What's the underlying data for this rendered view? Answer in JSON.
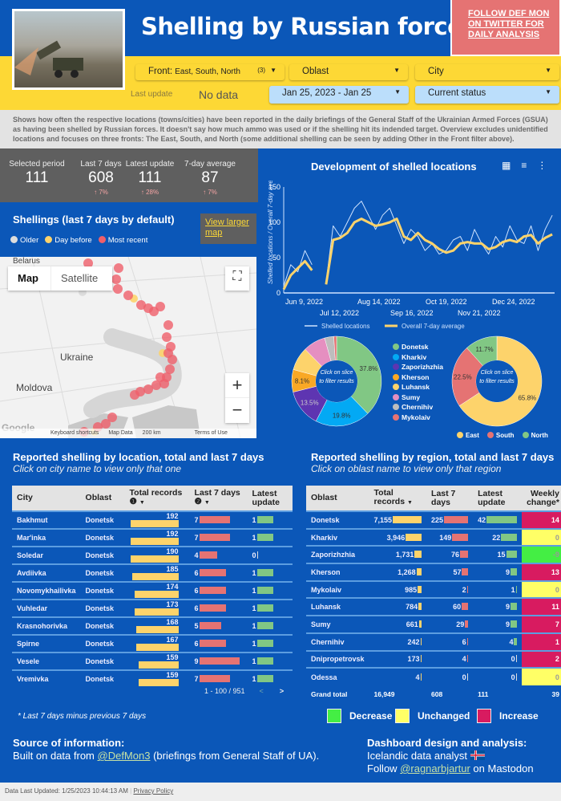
{
  "header": {
    "title": "Shelling by Russian forces",
    "follow_link": "FOLLOW DEF MON ON TWITTER FOR DAILY ANALYSIS",
    "image_alt": "rocket launcher firing"
  },
  "filters": {
    "front_label": "Front",
    "front_value": "East, South, North",
    "front_count": "(3)",
    "oblast": "Oblast",
    "city": "City",
    "last_update_label": "Last update",
    "last_update_value": "No data",
    "date_range": "Jan 25, 2023 - Jan 25",
    "status": "Current status"
  },
  "description": "Shows how often the respective locations (towns/cities) have been reported in the daily briefings of the General Staff of the Ukrainian Armed Forces (GSUA) as having been shelled by Russian forces. It doesn't say how much ammo was used or if the shelling hit its indended target. Overview excludes unidentified locations and focuses on three fronts: The East, South, and North (some additional shelling can be seen by adding Other in the Front filter above).",
  "stats": [
    {
      "label": "Selected period",
      "value": "111",
      "delta": ""
    },
    {
      "label": "Last 7 days",
      "value": "608",
      "delta": "↑ 7%"
    },
    {
      "label": "Latest update",
      "value": "111",
      "delta": "↑ 28%"
    },
    {
      "label": "7-day average",
      "value": "87",
      "delta": "↑ 7%"
    }
  ],
  "map": {
    "title": "Shellings (last 7 days by default)",
    "legend": [
      "Older",
      "Day before",
      "Most recent"
    ],
    "legend_colors": [
      "#dddddd",
      "#fdd36b",
      "#ef5f6a"
    ],
    "view_larger": "View larger map",
    "tab_map": "Map",
    "tab_satellite": "Satellite",
    "labels": {
      "ukraine": "Ukraine",
      "moldova": "Moldova",
      "belarus": "Belarus"
    },
    "attribution": {
      "google": "Google",
      "shortcuts": "Keyboard shortcuts",
      "mapdata": "Map Data",
      "scale": "200 km",
      "terms": "Terms of Use"
    }
  },
  "chart": {
    "title": "Development of shelled locations"
  },
  "chart_data": [
    {
      "type": "line",
      "title": "Development of shelled locations",
      "ylabel": "Shelled locations / Overall 7-day average",
      "ylim": [
        0,
        150
      ],
      "yticks": [
        0,
        50,
        100,
        150
      ],
      "xticks_top": [
        "Jun 9, 2022",
        "Aug 14, 2022",
        "Oct 19, 2022",
        "Dec 24, 2022"
      ],
      "xticks_bottom": [
        "Jul 12, 2022",
        "Sep 16, 2022",
        "Nov 21, 2022"
      ],
      "x": [
        "2022-06-09",
        "2022-06-15",
        "2022-06-21",
        "2022-06-27",
        "2022-07-03",
        "2022-07-09",
        "2022-07-15",
        "2022-07-21",
        "2022-07-27",
        "2022-08-02",
        "2022-08-08",
        "2022-08-14",
        "2022-08-20",
        "2022-08-26",
        "2022-09-01",
        "2022-09-07",
        "2022-09-13",
        "2022-09-19",
        "2022-09-25",
        "2022-10-01",
        "2022-10-07",
        "2022-10-13",
        "2022-10-19",
        "2022-10-25",
        "2022-10-31",
        "2022-11-06",
        "2022-11-12",
        "2022-11-18",
        "2022-11-24",
        "2022-11-30",
        "2022-12-06",
        "2022-12-12",
        "2022-12-18",
        "2022-12-24",
        "2022-12-30",
        "2023-01-05",
        "2023-01-11",
        "2023-01-17",
        "2023-01-23"
      ],
      "series": [
        {
          "name": "Shelled locations",
          "color": "#cfe3ff",
          "values": [
            10,
            40,
            30,
            60,
            40,
            null,
            15,
            95,
            80,
            100,
            120,
            130,
            110,
            90,
            110,
            120,
            95,
            70,
            90,
            80,
            60,
            70,
            55,
            60,
            75,
            80,
            60,
            90,
            70,
            55,
            80,
            65,
            95,
            75,
            70,
            95,
            60,
            90,
            110
          ]
        },
        {
          "name": "Overall 7-day average",
          "color": "#fdd36b",
          "values": [
            5,
            25,
            35,
            45,
            32,
            null,
            12,
            75,
            78,
            85,
            100,
            105,
            100,
            95,
            97,
            100,
            105,
            80,
            75,
            85,
            75,
            70,
            62,
            57,
            60,
            70,
            72,
            70,
            70,
            62,
            65,
            72,
            75,
            72,
            80,
            82,
            70,
            78,
            83
          ]
        }
      ]
    },
    {
      "type": "pie",
      "title": "",
      "center_text": "Click on slice to filter results",
      "categories": [
        "Donetsk",
        "Kharkiv",
        "Zaporizhzhia",
        "Kherson",
        "Luhansk",
        "Sumy",
        "Chernihiv",
        "Mykolaiv"
      ],
      "values": [
        37.8,
        19.8,
        13.5,
        8.1,
        8.4,
        8.1,
        3.3,
        1.0
      ],
      "labels_shown": [
        "37.8%",
        "19.8%",
        "13.5%",
        "8.1%",
        "",
        "",
        "",
        ""
      ],
      "colors": [
        "#81c784",
        "#03a9f4",
        "#5e35b1",
        "#f9a825",
        "#fdd36b",
        "#e58fc0",
        "#bdbdbd",
        "#e57373"
      ],
      "legend": "right"
    },
    {
      "type": "pie",
      "title": "",
      "center_text": "Click on slice to filter results",
      "categories": [
        "East",
        "South",
        "North"
      ],
      "values": [
        65.8,
        22.5,
        11.7
      ],
      "labels_shown": [
        "65.8%",
        "22.5%",
        "11.7%"
      ],
      "colors": [
        "#fdd36b",
        "#e57373",
        "#81c784"
      ],
      "legend": "bottom"
    }
  ],
  "city_section": {
    "title": "Reported shelling by location, total and last 7 days",
    "subtitle": "Click on city name to view only that one",
    "columns": [
      "City",
      "Oblast",
      "Total records",
      "Last 7 days",
      "Latest update"
    ],
    "col_notes": [
      "❶",
      "❷"
    ],
    "rows": [
      [
        "Bakhmut",
        "Donetsk",
        192,
        7,
        1
      ],
      [
        "Mar'inka",
        "Donetsk",
        192,
        7,
        1
      ],
      [
        "Soledar",
        "Donetsk",
        190,
        4,
        0
      ],
      [
        "Avdiivka",
        "Donetsk",
        185,
        6,
        1
      ],
      [
        "Novomykhailivka",
        "Donetsk",
        174,
        6,
        1
      ],
      [
        "Vuhledar",
        "Donetsk",
        173,
        6,
        1
      ],
      [
        "Krasnohorivka",
        "Donetsk",
        168,
        5,
        1
      ],
      [
        "Spirne",
        "Donetsk",
        167,
        6,
        1
      ],
      [
        "Vesele",
        "Donetsk",
        159,
        9,
        1
      ],
      [
        "Vremivka",
        "Donetsk",
        159,
        7,
        1
      ]
    ],
    "pager": "1 - 100 / 951"
  },
  "oblast_section": {
    "title": "Reported shelling by region, total and last 7 days",
    "subtitle": "Click on oblast name to view only that region",
    "columns": [
      "Oblast",
      "Total records",
      "Last 7 days",
      "Latest update",
      "Weekly change*"
    ],
    "rows": [
      [
        "Donetsk",
        "7,155",
        "225",
        "42",
        14
      ],
      [
        "Kharkiv",
        "3,946",
        "149",
        "22",
        0
      ],
      [
        "Zaporizhzhia",
        "1,731",
        "76",
        "15",
        -9
      ],
      [
        "Kherson",
        "1,268",
        "57",
        "9",
        13
      ],
      [
        "Mykolaiv",
        "985",
        "2",
        "1",
        0
      ],
      [
        "Luhansk",
        "784",
        "60",
        "9",
        11
      ],
      [
        "Sumy",
        "661",
        "29",
        "9",
        7
      ],
      [
        "Chernihiv",
        "242",
        "6",
        "4",
        1
      ],
      [
        "Dnipropetrovsk",
        "173",
        "4",
        "0",
        2
      ],
      [
        "Odessa",
        "4",
        "0",
        "0",
        0
      ]
    ],
    "total": [
      "Grand total",
      "16,949",
      "608",
      "111",
      "39"
    ]
  },
  "legend": {
    "note": "* Last 7 days minus previous 7 days",
    "items": [
      {
        "label": "Decrease",
        "color": "#44ee44"
      },
      {
        "label": "Unchanged",
        "color": "#ffff66"
      },
      {
        "label": "Increase",
        "color": "#d81b60"
      }
    ]
  },
  "source": {
    "heading": "Source of information:",
    "pre": "Built on data from ",
    "link": "@DefMon3",
    "post": " (briefings from General Staff of UA)."
  },
  "credits": {
    "heading": "Dashboard design and analysis:",
    "line1": "Icelandic data analyst",
    "pre": "Follow ",
    "link": "@ragnarbjartur",
    "post": " on Mastodon"
  },
  "footer": {
    "updated": "Data Last Updated: 1/25/2023 10:44:13 AM",
    "privacy": "Privacy Policy"
  },
  "colors": {
    "blue": "#0b57b8",
    "yellow": "#fdd835",
    "total_bar": "#fdd36b",
    "last7_bar": "#e57373",
    "latest_bar": "#81c784"
  }
}
